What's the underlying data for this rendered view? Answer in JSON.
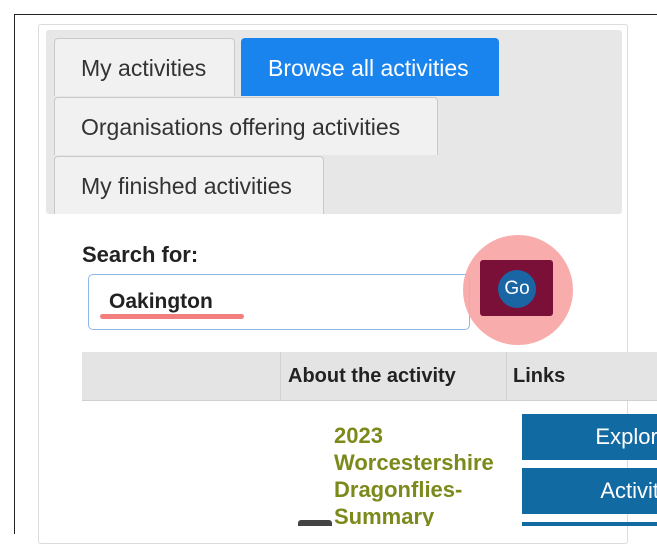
{
  "tabs": {
    "my_activities": "My activities",
    "browse_all": "Browse all activities",
    "organisations": "Organisations offering activities",
    "finished": "My finished activities"
  },
  "search": {
    "label": "Search for:",
    "value": "Oakington",
    "button_label": "Go"
  },
  "table": {
    "headers": [
      "",
      "About the activity",
      "Links"
    ],
    "rows": [
      {
        "title": "2023 Worcestershire Dragonflies- Summary",
        "links": [
          "Explore",
          "Activity"
        ]
      }
    ]
  },
  "colors": {
    "active_tab": "#1a84ee",
    "go_button": "#7a0f38",
    "highlight": "#f7a3a3",
    "title_green": "#7c8a1c",
    "link_button": "#126aa3"
  }
}
